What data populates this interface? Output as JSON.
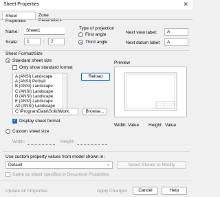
{
  "window": {
    "title": "Sheet Properties"
  },
  "tabs": [
    "Sheet Properties",
    "Zone Parameters"
  ],
  "name": {
    "label": "Name:",
    "value": "Sheet1"
  },
  "scale": {
    "label": "Scale:",
    "num": "1",
    "sep": ":",
    "den": "2"
  },
  "projection": {
    "title": "Type of projection",
    "first": "First angle",
    "third": "Third angle",
    "selected": "third"
  },
  "next_view": {
    "label": "Next view label:",
    "value": "A"
  },
  "next_datum": {
    "label": "Next datum label:",
    "value": "A"
  },
  "format": {
    "group": "Sheet Format/Size",
    "standard": "Standard sheet size",
    "only_standard": "Only show standard format",
    "reload": "Reload",
    "list": [
      "A (ANSI) Landscape",
      "A (ANSI) Portrait",
      "B (ANSI) Landscape",
      "C (ANSI) Landscape",
      "D (ANSI) Landscape",
      "E (ANSI) Landscape",
      "A0 (ANSI) Landscape"
    ],
    "path": "C:\\ProgramData\\SolidWork:",
    "browse": "Browse...",
    "display_format": "Display sheet format",
    "custom": "Custom sheet size",
    "width_label": "Width:",
    "height_label": "Height:"
  },
  "preview": {
    "title": "Preview",
    "width_label": "Width:",
    "width_value": "Value",
    "height_label": "Height:",
    "height_value": "Value"
  },
  "custom_props": {
    "label": "Use custom property values from model shown in:",
    "dropdown": "Default",
    "same_as": "Same as sheet specified in Document Properties",
    "select_btn": "Select Sheets to Modify"
  },
  "footer": {
    "update_all": "Update All Properties",
    "apply": "Apply Changes",
    "cancel": "Cancel",
    "help": "Help"
  }
}
